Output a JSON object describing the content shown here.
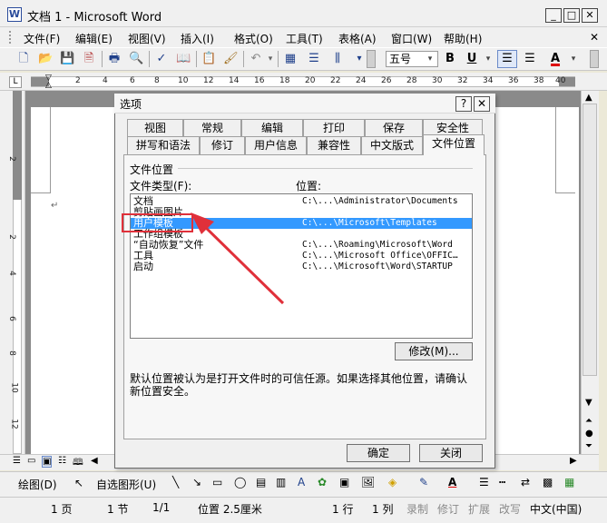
{
  "window": {
    "title": "文档 1 - Microsoft Word",
    "icon": "W",
    "controls": [
      "_",
      "□",
      "✕"
    ],
    "doc_close": "✕"
  },
  "menu": [
    "文件(F)",
    "编辑(E)",
    "视图(V)",
    "插入(I)",
    "格式(O)",
    "工具(T)",
    "表格(A)",
    "窗口(W)",
    "帮助(H)"
  ],
  "toolbar": {
    "font_size": "五号",
    "bold": "B",
    "underline": "U",
    "font_color": "A"
  },
  "ruler": {
    "h_numbers": [
      "2",
      "4",
      "6",
      "8",
      "10",
      "12",
      "14",
      "16",
      "18",
      "20",
      "22",
      "24",
      "26",
      "28",
      "30",
      "32",
      "34",
      "36",
      "38",
      "40"
    ],
    "v_numbers": [
      "2",
      "2",
      "4",
      "6",
      "8",
      "10",
      "12"
    ]
  },
  "document": {
    "paragraph_mark": "↵"
  },
  "dialog": {
    "title": "选项",
    "help_btn": "?",
    "close_btn": "✕",
    "tabs_row1": [
      "视图",
      "常规",
      "编辑",
      "打印",
      "保存",
      "安全性"
    ],
    "tabs_row2": [
      "拼写和语法",
      "修订",
      "用户信息",
      "兼容性",
      "中文版式",
      "文件位置"
    ],
    "active_tab": "文件位置",
    "group_label": "文件位置",
    "col_type_label": "文件类型(F):",
    "col_location_label": "位置:",
    "files": [
      {
        "type": "文档",
        "path": "C:\\...\\Administrator\\Documents"
      },
      {
        "type": "剪贴画图片",
        "path": ""
      },
      {
        "type": "用户模板",
        "path": "C:\\...\\Microsoft\\Templates",
        "selected": true
      },
      {
        "type": "工作组模板",
        "path": ""
      },
      {
        "type": "“自动恢复”文件",
        "path": "C:\\...\\Roaming\\Microsoft\\Word"
      },
      {
        "type": "工具",
        "path": "C:\\...\\Microsoft Office\\OFFIC…"
      },
      {
        "type": "启动",
        "path": "C:\\...\\Microsoft\\Word\\STARTUP"
      }
    ],
    "modify_button": "修改(M)...",
    "note": "默认位置被认为是打开文件时的可信任源。如果选择其他位置，请确认新位置安全。",
    "ok_button": "确定",
    "cancel_button": "关闭"
  },
  "drawbar": {
    "draw": "绘图(D)",
    "autoshapes": "自选图形(U)"
  },
  "status": {
    "page": "1 页",
    "section": "1 节",
    "page_of": "1/1",
    "position": "位置 2.5厘米",
    "line": "1 行",
    "column": "1 列",
    "rec": "录制",
    "trk": "修订",
    "ext": "扩展",
    "ovr": "改写",
    "lang": "中文(中国)"
  },
  "colors": {
    "selection": "#3399ff",
    "annotation_red": "#e0303a"
  }
}
